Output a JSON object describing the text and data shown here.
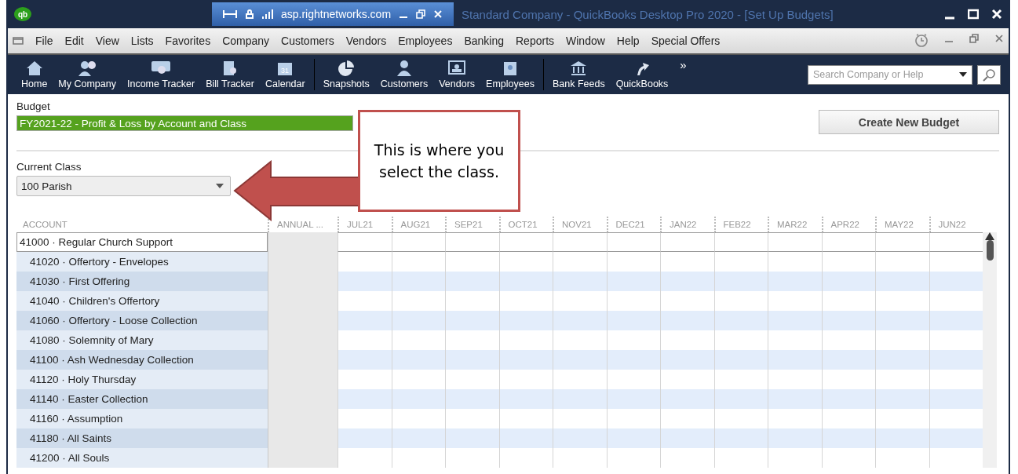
{
  "app_logo": "qb",
  "remote_bar": {
    "host": "asp.rightnetworks.com"
  },
  "window": {
    "title": "Standard Company - QuickBooks Desktop Pro 2020 - [Set Up Budgets]"
  },
  "menu": [
    "File",
    "Edit",
    "View",
    "Lists",
    "Favorites",
    "Company",
    "Customers",
    "Vendors",
    "Employees",
    "Banking",
    "Reports",
    "Window",
    "Help",
    "Special Offers"
  ],
  "toolbar": [
    {
      "kind": "home",
      "label": "Home"
    },
    {
      "kind": "company",
      "label": "My Company"
    },
    {
      "kind": "income",
      "label": "Income Tracker"
    },
    {
      "kind": "bill",
      "label": "Bill Tracker"
    },
    {
      "kind": "calendar",
      "label": "Calendar",
      "badge": "31"
    },
    {
      "kind": "sep"
    },
    {
      "kind": "pie",
      "label": "Snapshots"
    },
    {
      "kind": "person",
      "label": "Customers"
    },
    {
      "kind": "vendor",
      "label": "Vendors"
    },
    {
      "kind": "badge",
      "label": "Employees"
    },
    {
      "kind": "sep"
    },
    {
      "kind": "bank",
      "label": "Bank Feeds"
    },
    {
      "kind": "arrow",
      "label": "QuickBooks"
    }
  ],
  "toolbar_more": "»",
  "search": {
    "placeholder": "Search Company or Help"
  },
  "budget": {
    "label": "Budget",
    "value": "FY2021-22 - Profit & Loss by Account and Class"
  },
  "create_button": "Create New Budget",
  "current_class": {
    "label": "Current Class",
    "value": "100 Parish"
  },
  "callout": {
    "text": "This is where you select the class."
  },
  "table": {
    "columns": [
      "ACCOUNT",
      "ANNUAL ...",
      "JUL21",
      "AUG21",
      "SEP21",
      "OCT21",
      "NOV21",
      "DEC21",
      "JAN22",
      "FEB22",
      "MAR22",
      "APR22",
      "MAY22",
      "JUN22"
    ],
    "rows": [
      {
        "account": "41000 · Regular Church Support",
        "selected": true,
        "children": [
          {
            "account": "41020 · Offertory - Envelopes",
            "selected": false
          },
          {
            "account": "41030 · First Offering",
            "selected": false
          },
          {
            "account": "41040 · Children's Offertory",
            "selected": false
          },
          {
            "account": "41060 · Offertory - Loose Collection",
            "selected": false
          },
          {
            "account": "41080 · Solemnity of Mary",
            "selected": false
          },
          {
            "account": "41100 · Ash Wednesday Collection",
            "selected": false
          },
          {
            "account": "41120 · Holy Thursday",
            "selected": false
          },
          {
            "account": "41140 · Easter Collection",
            "selected": false
          },
          {
            "account": "41160 · Assumption",
            "selected": false
          },
          {
            "account": "41180 · All Saints",
            "selected": false
          },
          {
            "account": "41200 · All Souls",
            "selected": false
          }
        ]
      }
    ]
  }
}
